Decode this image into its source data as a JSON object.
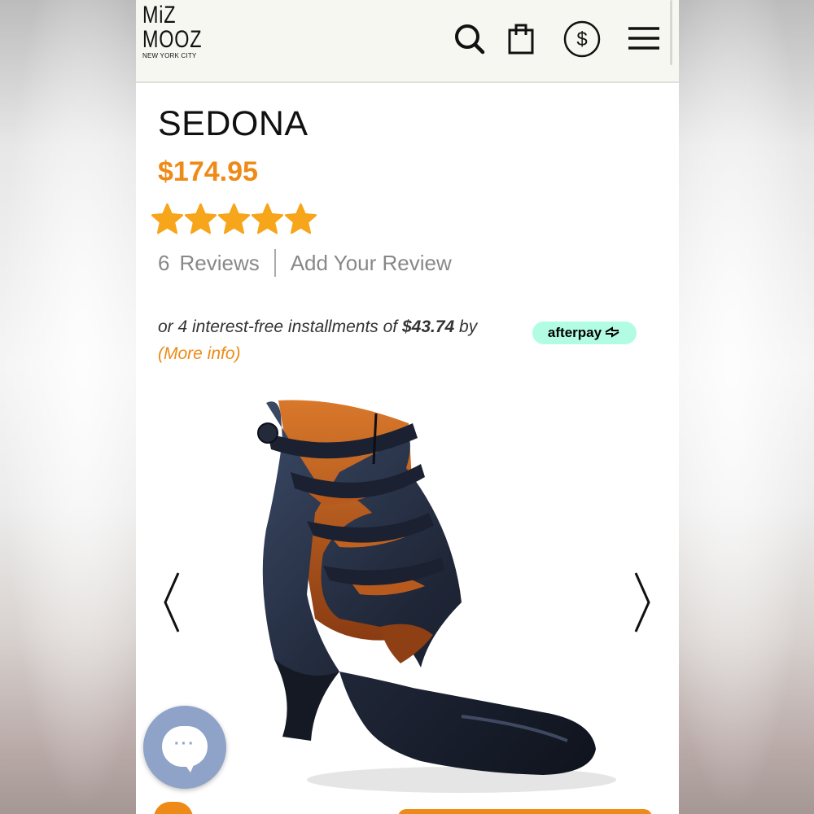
{
  "brand": {
    "logo_line1": "MiZ",
    "logo_line2": "MOOZ",
    "logo_sub": "NEW YORK CITY"
  },
  "header_icons": [
    "search-icon",
    "shopping-bag-icon",
    "currency-icon",
    "menu-icon"
  ],
  "product": {
    "name": "SEDONA",
    "price": "$174.95",
    "rating": 5,
    "rating_max": 5,
    "review_count": "6",
    "reviews_label": "Reviews",
    "add_review_label": "Add Your Review"
  },
  "installments": {
    "prefix": "or 4 interest-free installments of ",
    "amount": "$43.74",
    "suffix": " by",
    "provider": "afterpay",
    "more_info": "(More info)"
  },
  "gallery": {
    "prev_icon": "chevron-left-icon",
    "next_icon": "chevron-right-icon",
    "image": "black-leather-ankle-bootie"
  },
  "colors": {
    "accent": "#ee8a17",
    "afterpay": "#b2fce4",
    "chat": "#8fa2c7",
    "header_bg": "#f7f7f1"
  }
}
